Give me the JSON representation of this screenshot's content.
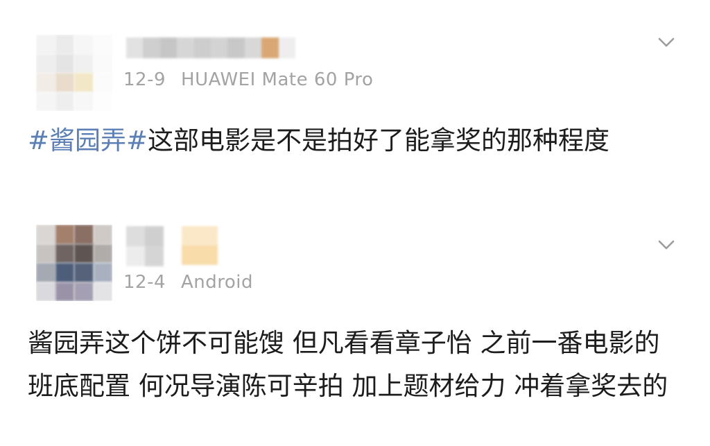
{
  "posts": [
    {
      "date": "12-9",
      "device": "HUAWEI Mate 60 Pro",
      "hashtag": "#酱园弄#",
      "text": "这部电影是不是拍好了能拿奖的那种程度",
      "avatar_tiles": [
        "#f3f3f3",
        "#ebebeb",
        "#f6f6f6",
        "#fbfbfb",
        "#eeeeee",
        "#e4e4e4",
        "#f0f0f0",
        "#fafafa",
        "#f1ece6",
        "#e9dccd",
        "#f2e8c8",
        "#fbfbfb",
        "#f5f5f5",
        "#eeeeee",
        "#f7f7f7",
        "#fdfdfd"
      ],
      "name_tiles": [
        "#e2e2e2",
        "#cfcfcf",
        "#c6c6c6",
        "#d6d6d6",
        "#cdcdcd",
        "#d3d3d3",
        "#c8c8c8",
        "#d8d8d8",
        "#d9a774",
        "#eeeeee"
      ]
    },
    {
      "date": "12-4",
      "device": "Android",
      "text": "酱园弄这个饼不可能馊 但凡看看章子怡 之前一番电影的班底配置 何况导演陈可辛拍 加上题材给力 冲着拿奖去的",
      "avatar_tiles": [
        "#d9d6d3",
        "#a3806c",
        "#8a6f64",
        "#cfcac6",
        "#c7c3c0",
        "#6f6462",
        "#5e5553",
        "#b0aca9",
        "#a5a9b1",
        "#4e5e7a",
        "#56627a",
        "#a9b1c0",
        "#d9d9de",
        "#9a93a8",
        "#a49fb2",
        "#e3e3e6"
      ],
      "name_tiles": [
        "#dddddd",
        "#cfcfcf",
        "#ececec",
        "#d5d5d5"
      ],
      "name_accent_tiles": [
        "#fbe8c8",
        "#f8dcaa"
      ]
    }
  ],
  "icons": {
    "expand": "chevron-down-icon"
  }
}
